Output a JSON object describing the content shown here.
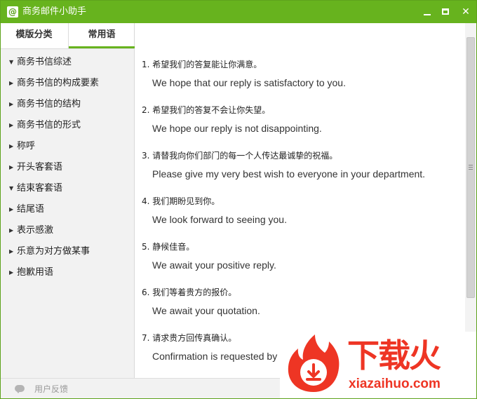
{
  "window": {
    "title": "商务邮件小助手",
    "icon": "at-icon"
  },
  "tabs": [
    {
      "label": "模版分类",
      "active": false
    },
    {
      "label": "常用语",
      "active": true
    }
  ],
  "sidebar": {
    "items": [
      {
        "label": "商务书信综述",
        "expanded": true
      },
      {
        "label": "商务书信的构成要素",
        "expanded": false
      },
      {
        "label": "商务书信的结构",
        "expanded": false
      },
      {
        "label": "商务书信的形式",
        "expanded": false
      },
      {
        "label": "称呼",
        "expanded": false
      },
      {
        "label": "开头客套语",
        "expanded": false
      },
      {
        "label": "结束客套语",
        "expanded": true
      },
      {
        "label": "结尾语",
        "expanded": false
      },
      {
        "label": "表示感激",
        "expanded": false
      },
      {
        "label": "乐意为对方做某事",
        "expanded": false
      },
      {
        "label": "抱歉用语",
        "expanded": false
      }
    ]
  },
  "content": {
    "entries": [
      {
        "zh": "1. 希望我们的答复能让你满意。",
        "en": "We hope that our reply is satisfactory to you."
      },
      {
        "zh": "2. 希望我们的答复不会让你失望。",
        "en": "We hope our reply is not disappointing."
      },
      {
        "zh": "3. 请替我向你们部门的每一个人传达最诚挚的祝福。",
        "en": "Please give my very best wish to everyone in your department."
      },
      {
        "zh": "4. 我们期盼见到你。",
        "en": "We look forward to seeing you."
      },
      {
        "zh": "5. 静候佳音。",
        "en": "We await your positive reply."
      },
      {
        "zh": "6. 我们等着贵方的报价。",
        "en": "We await your quotation."
      },
      {
        "zh": "7. 请求贵方回传真确认。",
        "en": "Confirmation is requested by"
      }
    ]
  },
  "footer": {
    "feedback_label": "用户反馈"
  },
  "watermark": {
    "title": "下载火",
    "subtitle": "xiazaihuo.com"
  },
  "colors": {
    "titlebar": "#67b31e",
    "accent": "#67b31e",
    "watermark": "#ee3524"
  }
}
